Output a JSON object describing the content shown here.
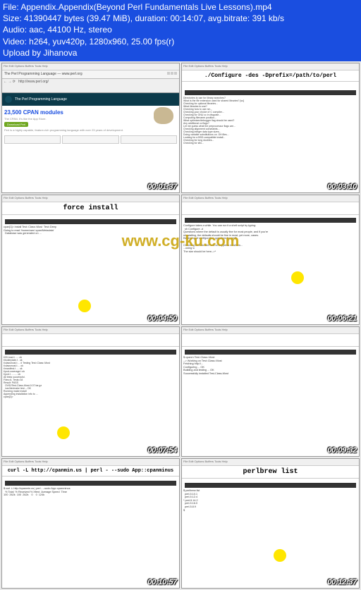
{
  "meta": {
    "file_label": "File:",
    "file": "Appendix.Appendix(Beyond Perl Fundamentals Live Lessons).mp4",
    "size_label": "Size:",
    "size": "41390447 bytes (39.47 MiB), duration: 00:14:07, avg.bitrate: 391 kb/s",
    "audio_label": "Audio:",
    "audio": "aac, 44100 Hz, stereo",
    "video_label": "Video:",
    "video": "h264, yuv420p, 1280x960, 25.00 fps(r)",
    "upload": "Upload by Jihanova"
  },
  "menu": "File  Edit  Options  Buffers  Tools  Help",
  "thumbs": [
    {
      "ts": "00:01:37",
      "banner": "The Perl Programming Language",
      "cpan": "23,500 CPAN modules",
      "cpan_sub": "The CPAN. It's like the App Store.",
      "dl": "Download Perl",
      "blurb": "Perl is a highly capable, feature-rich programming language with over 23 years of development."
    },
    {
      "ts": "00:03:10",
      "cmd": "./Configure -des -Dprefix=/path/to/perl"
    },
    {
      "ts": "00:04:50",
      "cmd": "force install"
    },
    {
      "ts": "00:06:21"
    },
    {
      "ts": "00:07:54"
    },
    {
      "ts": "00:09:32"
    },
    {
      "ts": "00:10:57",
      "cmd": "curl -L http://cpanmin.us | perl - --sudo App::cpanminus"
    },
    {
      "ts": "00:12:37",
      "cmd": "perlbrew list"
    }
  ],
  "watermark": "www.cg-ku.com"
}
